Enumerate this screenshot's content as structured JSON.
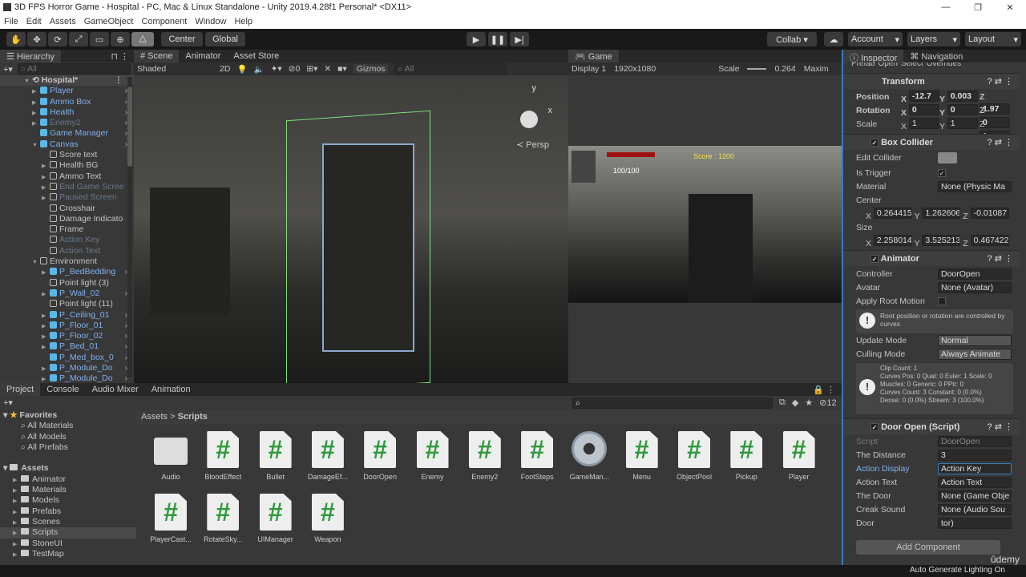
{
  "window": {
    "title": "3D FPS Horror Game - Hospital - PC, Mac & Linux Standalone - Unity 2019.4.28f1 Personal* <DX11>",
    "controls": [
      "—",
      "❐",
      "✕"
    ]
  },
  "menu": [
    "File",
    "Edit",
    "Assets",
    "GameObject",
    "Component",
    "Window",
    "Help"
  ],
  "toolbar": {
    "tools": [
      "✋",
      "✥",
      "⟳",
      "⤢",
      "▭",
      "⊕",
      "⧋"
    ],
    "pivot": "Center",
    "space": "Global",
    "play": "▶",
    "pause": "❚❚",
    "step": "▶|",
    "collab": "Collab ▾",
    "account": "Account",
    "layers": "Layers",
    "layout": "Layout"
  },
  "hierarchy": {
    "tab": "Hierarchy",
    "search_placeholder": "All",
    "scene": "Hospital*",
    "items": [
      {
        "label": "Player",
        "kind": "prefab",
        "depth": 1,
        "expand": true
      },
      {
        "label": "Ammo Box",
        "kind": "prefab",
        "depth": 1,
        "expand": true
      },
      {
        "label": "Health",
        "kind": "prefab",
        "depth": 1,
        "expand": true
      },
      {
        "label": "Enemy2",
        "kind": "prefab-dim",
        "depth": 1,
        "expand": true
      },
      {
        "label": "Game Manager",
        "kind": "prefab",
        "depth": 1,
        "expand": false
      },
      {
        "label": "Canvas",
        "kind": "prefab",
        "depth": 1,
        "expand": true,
        "open": true
      },
      {
        "label": "Score text",
        "kind": "object",
        "depth": 2
      },
      {
        "label": "Health BG",
        "kind": "object",
        "depth": 2,
        "expand": true
      },
      {
        "label": "Ammo  Text",
        "kind": "object",
        "depth": 2,
        "expand": true
      },
      {
        "label": "End Game Scree",
        "kind": "dim",
        "depth": 2,
        "expand": true
      },
      {
        "label": "Paused Screen",
        "kind": "dim",
        "depth": 2,
        "expand": true
      },
      {
        "label": "Crosshair",
        "kind": "object",
        "depth": 2
      },
      {
        "label": "Damage Indicato",
        "kind": "object",
        "depth": 2
      },
      {
        "label": "Frame",
        "kind": "object",
        "depth": 2
      },
      {
        "label": "Action Key",
        "kind": "dim-gray",
        "depth": 2
      },
      {
        "label": "Action Text",
        "kind": "dim-gray",
        "depth": 2
      },
      {
        "label": "Environment",
        "kind": "object",
        "depth": 1,
        "open": true
      },
      {
        "label": "P_BedBedding",
        "kind": "prefab",
        "depth": 2,
        "expand": true
      },
      {
        "label": "Point light (3)",
        "kind": "object",
        "depth": 2
      },
      {
        "label": "P_Wall_02",
        "kind": "prefab",
        "depth": 2,
        "expand": true
      },
      {
        "label": "Point light (11)",
        "kind": "object",
        "depth": 2
      },
      {
        "label": "P_Ceiling_01",
        "kind": "prefab",
        "depth": 2,
        "expand": true
      },
      {
        "label": "P_Floor_01",
        "kind": "prefab",
        "depth": 2,
        "expand": true
      },
      {
        "label": "P_Floor_02",
        "kind": "prefab",
        "depth": 2,
        "expand": true
      },
      {
        "label": "P_Bed_01",
        "kind": "prefab",
        "depth": 2,
        "expand": true
      },
      {
        "label": "P_Med_box_0",
        "kind": "prefab",
        "depth": 2
      },
      {
        "label": "P_Module_Do",
        "kind": "prefab",
        "depth": 2,
        "expand": true
      },
      {
        "label": "P_Module_Do",
        "kind": "prefab",
        "depth": 2,
        "expand": true
      }
    ]
  },
  "scene": {
    "tabs": [
      "# Scene",
      "Animator",
      "Asset Store"
    ],
    "shading": "Shaded",
    "mode2d": "2D",
    "hidden_count": "0",
    "gizmos": "Gizmos",
    "search_placeholder": "All",
    "persp": "Persp",
    "axis_x": "x",
    "axis_y": "y"
  },
  "game": {
    "tab": "Game",
    "display": "Display 1",
    "resolution": "1920x1080",
    "scale_label": "Scale",
    "scale_value": "0.264",
    "maximize": "Maxim",
    "score": "Score : 1200",
    "health": "100/100"
  },
  "inspector": {
    "tabs": [
      "Inspector",
      "Navigation"
    ],
    "prefab_label": "Prefab",
    "prefab_open": "Open",
    "prefab_select": "Select",
    "overrides": "Overrides",
    "transform": {
      "title": "Transform",
      "position": {
        "label": "Position",
        "x": "-12.7",
        "y": "0.003",
        "z": "1.97"
      },
      "rotation": {
        "label": "Rotation",
        "x": "0",
        "y": "0",
        "z": "0"
      },
      "scale": {
        "label": "Scale",
        "x": "1",
        "y": "1",
        "z": "1"
      }
    },
    "box_collider": {
      "title": "Box Collider",
      "edit_collider": "Edit Collider",
      "is_trigger": "Is Trigger",
      "is_trigger_value": true,
      "material": "Material",
      "material_value": "None (Physic Ma",
      "center": "Center",
      "center_x": "0.264415",
      "center_y": "1.262606",
      "center_z": "-0.01087",
      "size": "Size",
      "size_x": "2.258014",
      "size_y": "3.525213",
      "size_z": "0.467422"
    },
    "animator": {
      "title": "Animator",
      "controller": "Controller",
      "controller_value": "DoorOpen",
      "avatar": "Avatar",
      "avatar_value": "None (Avatar)",
      "apply_root_motion": "Apply Root Motion",
      "root_info": "Root position or rotation are controlled by curves",
      "update_mode": "Update Mode",
      "update_mode_value": "Normal",
      "culling_mode": "Culling Mode",
      "culling_mode_value": "Always Animate",
      "clip_info": [
        "Clip Count: 1",
        "Curves Pos: 0 Quat: 0 Euler: 1 Scale: 0",
        "Muscles: 0 Generic: 0 PPtr: 0",
        "Curves Count: 3 Constant: 0 (0.0%)",
        "Dense: 0 (0.0%) Stream: 3 (100.0%)"
      ]
    },
    "door_open": {
      "title": "Door Open (Script)",
      "script": "Script",
      "script_value": "DoorOpen",
      "distance": "The Distance",
      "distance_value": "3",
      "action_display": "Action Display",
      "action_display_value": "Action Key",
      "action_text": "Action Text",
      "action_text_value": "Action Text",
      "the_door": "The Door",
      "the_door_value": "None (Game Obje",
      "creak_sound": "Creak Sound",
      "creak_sound_value": "None (Audio Sou",
      "door_anim": "Door",
      "door_anim_value": "tor)"
    },
    "add_component": "Add Component"
  },
  "project": {
    "tabs": [
      "Project",
      "Console",
      "Audio Mixer",
      "Animation"
    ],
    "hidden_count": "12",
    "favorites": "Favorites",
    "favorite_items": [
      "All Materials",
      "All Models",
      "All Prefabs"
    ],
    "assets": "Assets",
    "folders": [
      "Animator",
      "Materials",
      "Models",
      "Prefabs",
      "Scenes",
      "Scripts",
      "StoneUI",
      "TestMap"
    ],
    "breadcrumb": [
      "Assets",
      "Scripts"
    ],
    "files": [
      {
        "name": "Audio",
        "type": "folder"
      },
      {
        "name": "BloodEffect",
        "type": "script"
      },
      {
        "name": "Bullet",
        "type": "script"
      },
      {
        "name": "DamageEf...",
        "type": "script"
      },
      {
        "name": "DoorOpen",
        "type": "script"
      },
      {
        "name": "Enemy",
        "type": "script"
      },
      {
        "name": "Enemy2",
        "type": "script"
      },
      {
        "name": "FootSteps",
        "type": "script"
      },
      {
        "name": "GameMan...",
        "type": "gear"
      },
      {
        "name": "Menu",
        "type": "script"
      },
      {
        "name": "ObjectPool",
        "type": "script"
      },
      {
        "name": "Pickup",
        "type": "script"
      },
      {
        "name": "Player",
        "type": "script"
      },
      {
        "name": "PlayerCast...",
        "type": "script"
      },
      {
        "name": "RotateSky...",
        "type": "script"
      },
      {
        "name": "UIManager",
        "type": "script"
      },
      {
        "name": "Weapon",
        "type": "script"
      }
    ]
  },
  "status": {
    "text": "Auto Generate Lighting On",
    "brand": "ûdemy"
  },
  "colors": {
    "accent": "#3a79bb",
    "prefab": "#7fb0ee",
    "script_hash": "#2e9a3c"
  }
}
